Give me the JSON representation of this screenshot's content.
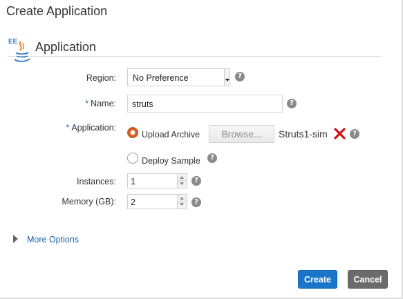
{
  "dialog": {
    "title": "Create Application"
  },
  "section": {
    "title": "Application",
    "icon": "java-ee-icon"
  },
  "form": {
    "region": {
      "label": "Region:",
      "value": "No Preference"
    },
    "name": {
      "required_mark": "*",
      "label": "Name:",
      "value": "struts"
    },
    "application": {
      "required_mark": "*",
      "label": "Application:",
      "upload_label": "Upload Archive",
      "upload_selected": true,
      "browse_label": "Browse...",
      "file_name": "Struts1-sim",
      "deploy_label": "Deploy Sample",
      "deploy_selected": false
    },
    "instances": {
      "label": "Instances:",
      "value": "1"
    },
    "memory": {
      "label": "Memory (GB):",
      "value": "2"
    },
    "help_glyph": "?"
  },
  "more_options": {
    "label": "More Options"
  },
  "actions": {
    "create_label": "Create",
    "cancel_label": "Cancel"
  },
  "colors": {
    "accent": "#1a74c8",
    "radio_checked": "#c95a1c",
    "remove": "#cc1111",
    "cancel_bg": "#6b6b6b"
  }
}
